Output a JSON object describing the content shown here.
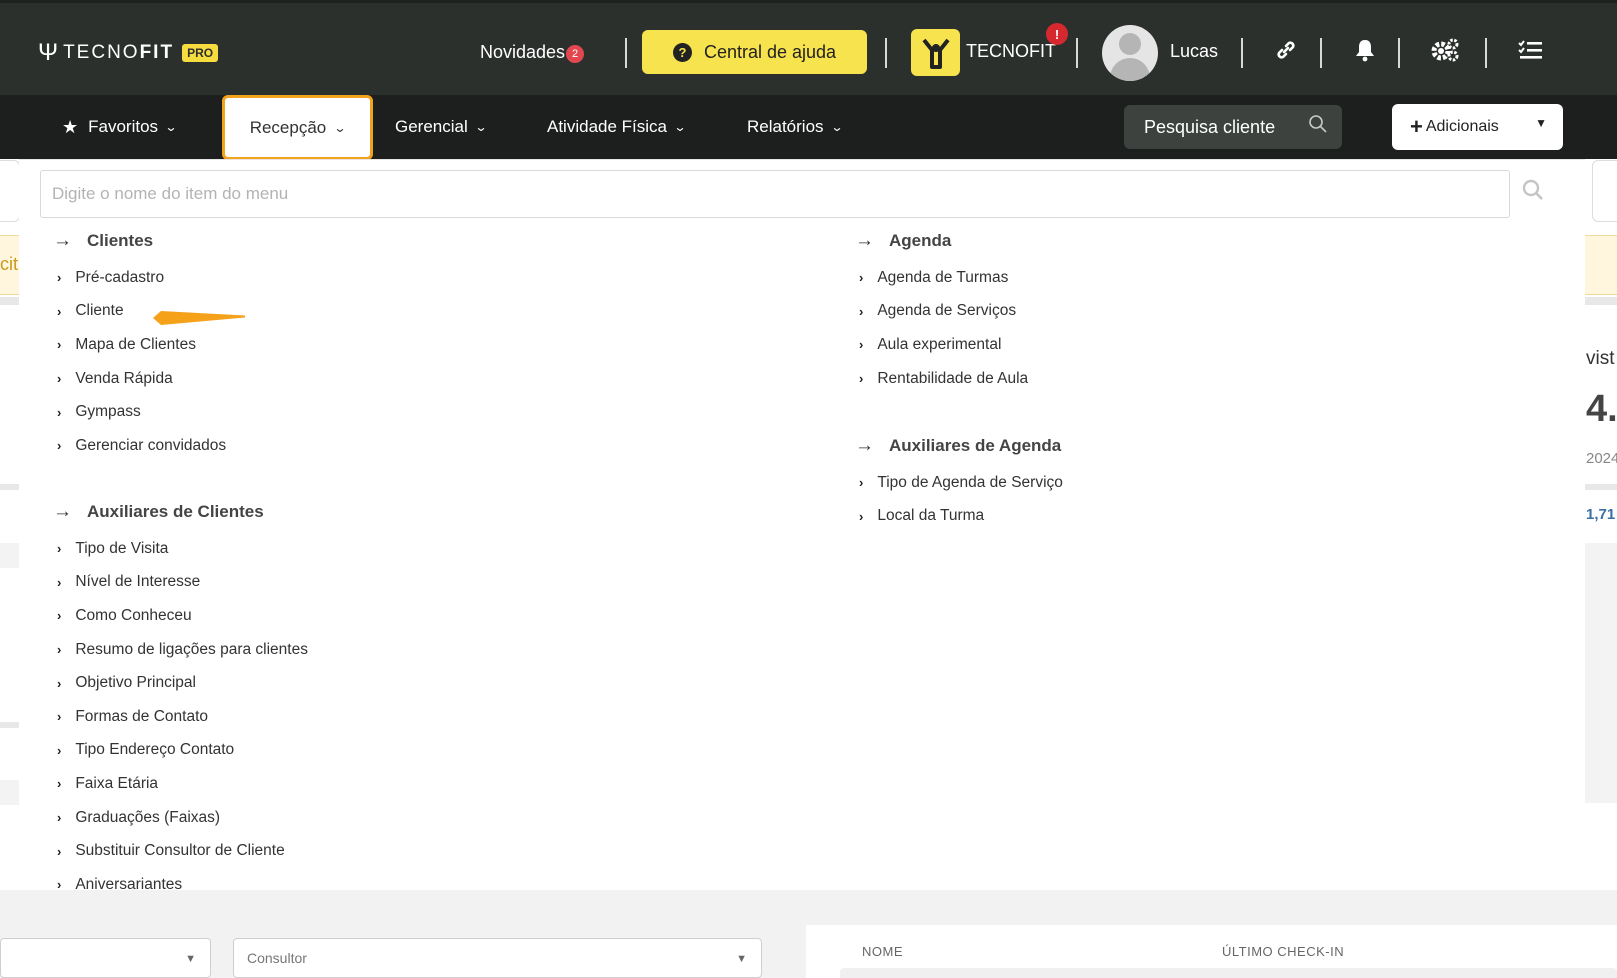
{
  "header": {
    "logo_text_light": "TECNO",
    "logo_text_bold": "FIT",
    "logo_badge": "PRO",
    "news_label": "Novidades",
    "news_count": "2",
    "help_label": "Central de ajuda",
    "unit_name": "TECNOFIT",
    "unit_alert": "!",
    "user_name": "Lucas"
  },
  "nav": {
    "favorites": "Favoritos",
    "reception": "Recepção",
    "management": "Gerencial",
    "physical_activity": "Atividade Física",
    "reports": "Relatórios",
    "search_placeholder": "Pesquisa cliente",
    "add_label": "Adicionais"
  },
  "menu": {
    "search_placeholder": "Digite o nome do item do menu",
    "clientes": {
      "title": "Clientes",
      "items": [
        "Pré-cadastro",
        "Cliente",
        "Mapa de Clientes",
        "Venda Rápida",
        "Gympass",
        "Gerenciar convidados"
      ]
    },
    "auxiliares_clientes": {
      "title": "Auxiliares de Clientes",
      "items": [
        "Tipo de Visita",
        "Nível de Interesse",
        "Como Conheceu",
        "Resumo de ligações para clientes",
        "Objetivo Principal",
        "Formas de Contato",
        "Tipo Endereço Contato",
        "Faixa Etária",
        "Graduações (Faixas)",
        "Substituir Consultor de Cliente",
        "Aniversariantes"
      ]
    },
    "agenda": {
      "title": "Agenda",
      "items": [
        "Agenda de Turmas",
        "Agenda de Serviços",
        "Aula experimental",
        "Rentabilidade de Aula"
      ]
    },
    "auxiliares_agenda": {
      "title": "Auxiliares de Agenda",
      "items": [
        "Tipo de Agenda de Serviço",
        "Local da Turma"
      ]
    }
  },
  "background": {
    "left_banner_fragment": "cit",
    "right_fragment_1": "vist",
    "right_fragment_2": "4.",
    "right_fragment_3": "2024",
    "right_fragment_4": "1,71",
    "consultant_select": "Consultor",
    "col_name": "NOME",
    "col_last_checkin": "ÚLTIMO CHECK-IN"
  },
  "colors": {
    "header_bg": "#2b302d",
    "nav_bg": "#1c1f1d",
    "accent_yellow": "#f7e34d",
    "active_outline": "#f3a21b",
    "badge_red": "#e2474f"
  }
}
